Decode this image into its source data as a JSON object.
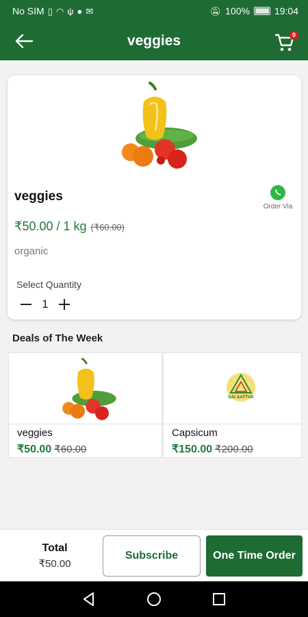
{
  "status_bar": {
    "carrier": "No SIM",
    "battery": "100%",
    "time": "19:04"
  },
  "app_bar": {
    "title": "veggies",
    "cart_count": "0"
  },
  "product": {
    "name": "veggies",
    "price": "₹50.00 / 1 kg",
    "old_price": "(₹60.00)",
    "description": "organic",
    "order_via_label": "Order Via",
    "quantity_label": "Select Quantity",
    "quantity": "1"
  },
  "deals": {
    "title": "Deals of The Week",
    "items": [
      {
        "name": "veggies",
        "price": "₹50.00",
        "old_price": "₹60.00"
      },
      {
        "name": "Capsicum",
        "price": "₹150.00",
        "old_price": "₹200.00",
        "logo_text": "SAI SATTVA"
      }
    ]
  },
  "bottom_bar": {
    "total_label": "Total",
    "total_value": "₹50.00",
    "subscribe_label": "Subscribe",
    "one_time_label": "One Time Order"
  },
  "colors": {
    "primary": "#1f6b34",
    "price_green": "#1f7a3a",
    "whatsapp": "#2eb842",
    "badge": "#d32020"
  }
}
